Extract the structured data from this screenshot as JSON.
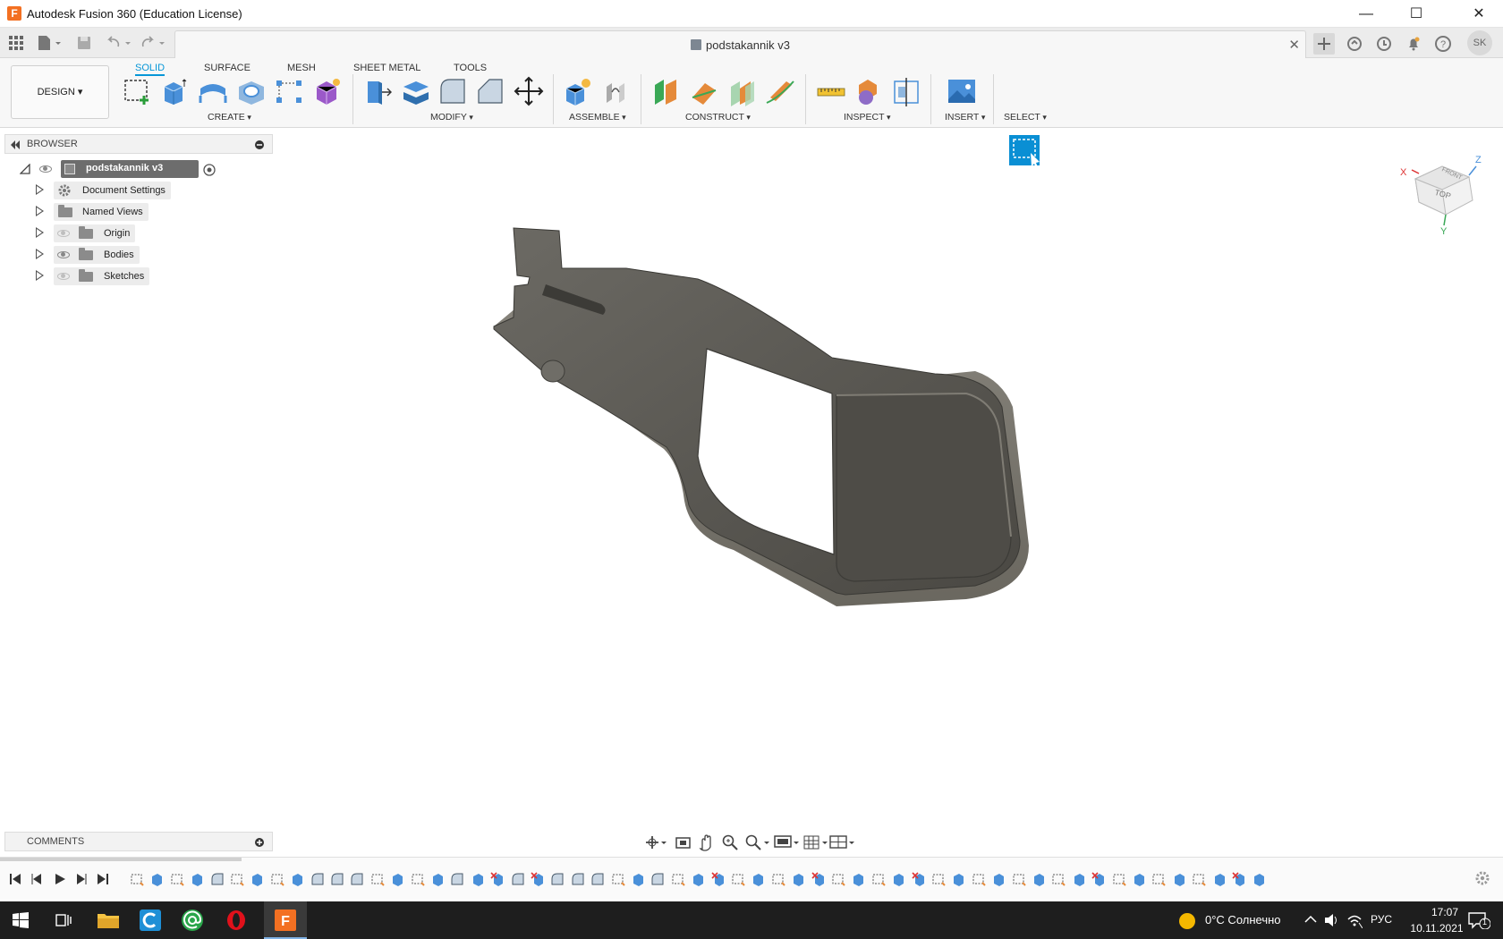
{
  "window": {
    "title": "Autodesk Fusion 360 (Education License)",
    "app_icon_letter": "F",
    "minimize": "—",
    "maximize": "☐",
    "close": "✕"
  },
  "document": {
    "tab_title": "podstakannik v3",
    "close_tab": "✕"
  },
  "user": {
    "initials": "SK"
  },
  "workspace": {
    "design_label": "DESIGN ▾"
  },
  "tabs": [
    {
      "label": "SOLID",
      "active": true
    },
    {
      "label": "SURFACE",
      "active": false
    },
    {
      "label": "MESH",
      "active": false
    },
    {
      "label": "SHEET METAL",
      "active": false
    },
    {
      "label": "TOOLS",
      "active": false
    }
  ],
  "groups": {
    "create": "CREATE",
    "modify": "MODIFY",
    "assemble": "ASSEMBLE",
    "construct": "CONSTRUCT",
    "inspect": "INSPECT",
    "insert": "INSERT",
    "select": "SELECT"
  },
  "browser": {
    "header": "BROWSER",
    "root": "podstakannik v3",
    "items": [
      {
        "label": "Document Settings",
        "icon": "gear-icon"
      },
      {
        "label": "Named Views",
        "icon": "folder-icon"
      },
      {
        "label": "Origin",
        "icon": "folder-icon"
      },
      {
        "label": "Bodies",
        "icon": "folder-icon"
      },
      {
        "label": "Sketches",
        "icon": "folder-icon"
      }
    ]
  },
  "comments": {
    "header": "COMMENTS"
  },
  "viewcube": {
    "top": "TOP",
    "front": "FRONT",
    "axis_x": "X",
    "axis_y": "Y",
    "axis_z": "Z"
  },
  "taskbar": {
    "weather": "0°C Солнечно",
    "lang": "РУС",
    "time": "17:07",
    "date": "10.11.2021",
    "notif_count": "1"
  },
  "colors": {
    "accent": "#0696d7",
    "model": "#575550",
    "taskbar": "#1e1e1e",
    "fusion_orange": "#f37022"
  }
}
